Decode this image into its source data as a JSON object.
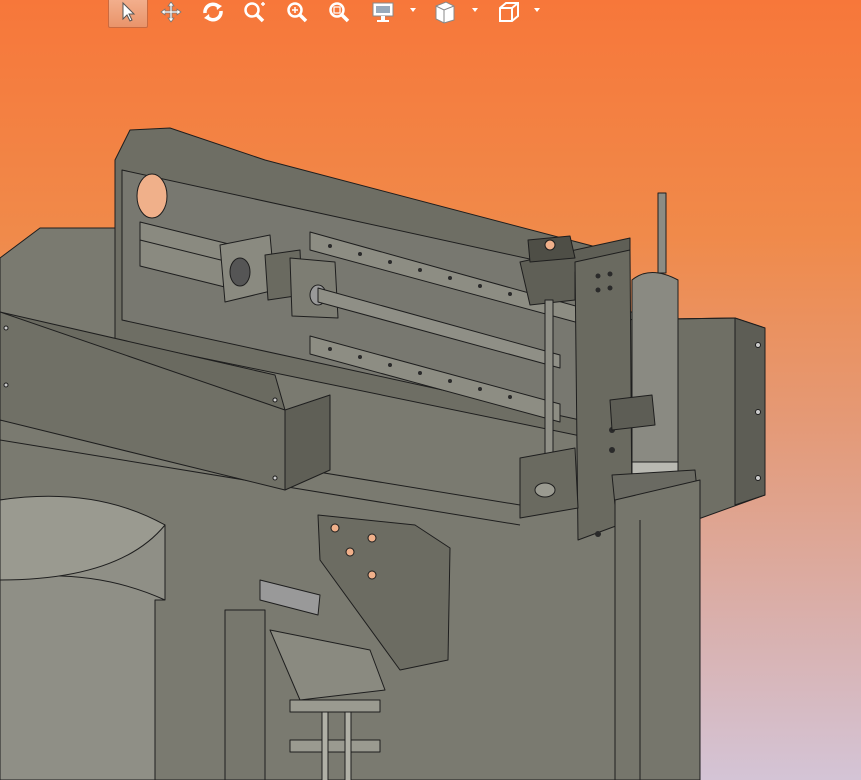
{
  "toolbar": {
    "tools": [
      {
        "icon": "select-arrow-icon",
        "active": true
      },
      {
        "icon": "pan-move-icon"
      },
      {
        "icon": "rotate-icon"
      },
      {
        "icon": "zoom-fit-icon"
      },
      {
        "icon": "zoom-in-icon"
      },
      {
        "icon": "zoom-area-icon"
      },
      {
        "icon": "display-monitor-icon",
        "dropdown": true
      },
      {
        "icon": "section-view-icon",
        "dropdown": true
      },
      {
        "icon": "view-cube-icon",
        "dropdown": true
      }
    ]
  },
  "colors": {
    "background_top": "#f7773a",
    "background_bottom": "#d4c4d6",
    "part_fill": "#7d7d72",
    "part_edge": "#1e1e1e",
    "toolbar_icon": "#ffffff"
  }
}
